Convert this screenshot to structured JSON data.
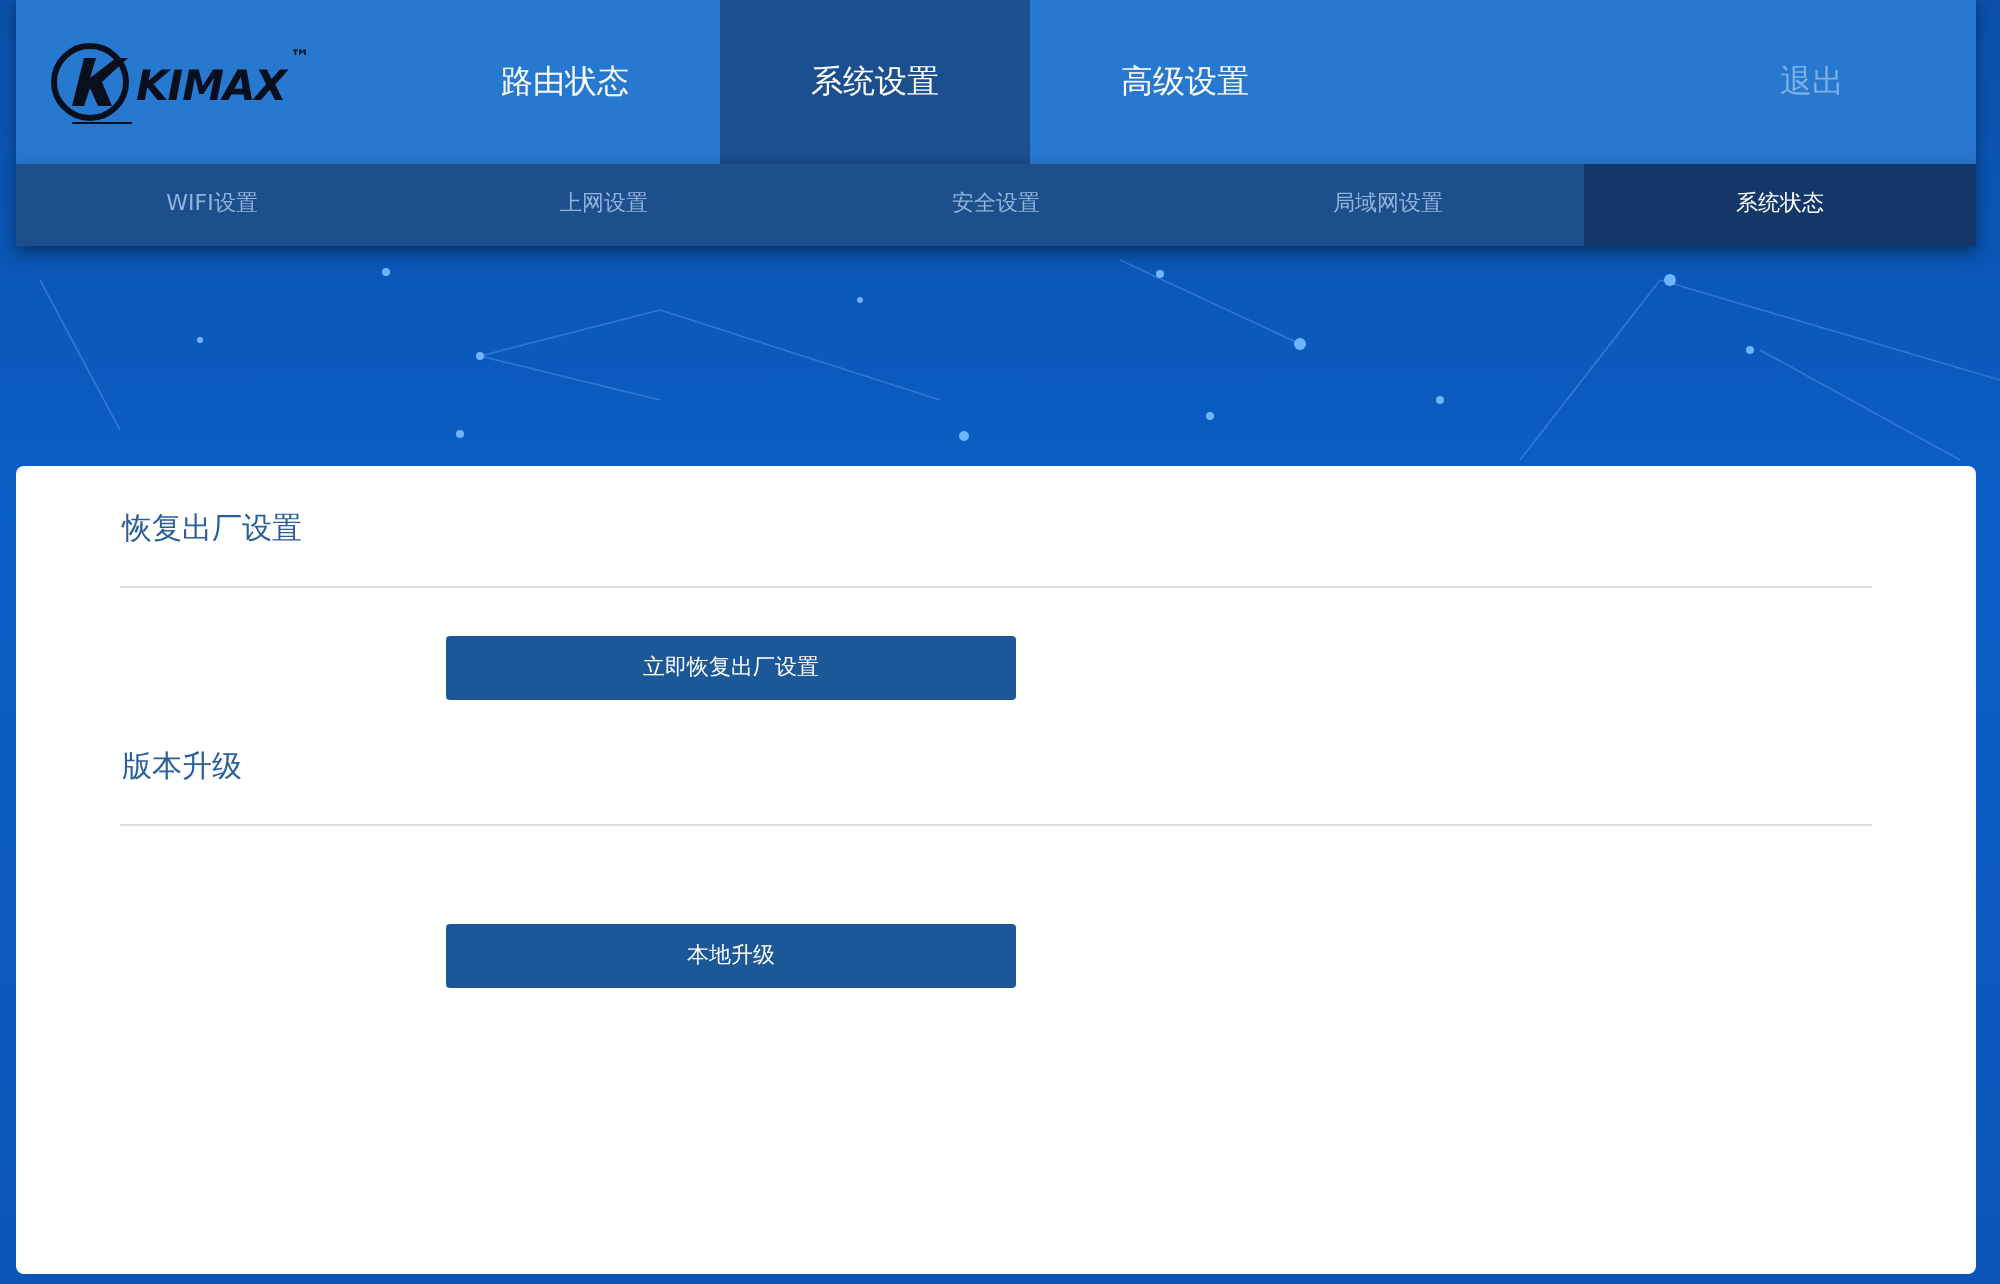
{
  "logo": {
    "text": "KIMAX",
    "trademark": "™"
  },
  "main_tabs": [
    {
      "label": "路由状态",
      "selected": false
    },
    {
      "label": "系统设置",
      "selected": true
    },
    {
      "label": "高级设置",
      "selected": false
    }
  ],
  "logout": "退出",
  "sub_tabs": [
    {
      "label": "WIFI设置",
      "selected": false
    },
    {
      "label": "上网设置",
      "selected": false
    },
    {
      "label": "安全设置",
      "selected": false
    },
    {
      "label": "局域网设置",
      "selected": false
    },
    {
      "label": "系统状态",
      "selected": true
    }
  ],
  "sections": [
    {
      "title": "恢复出厂设置",
      "button": "立即恢复出厂设置"
    },
    {
      "title": "版本升级",
      "button": "本地升级"
    }
  ]
}
